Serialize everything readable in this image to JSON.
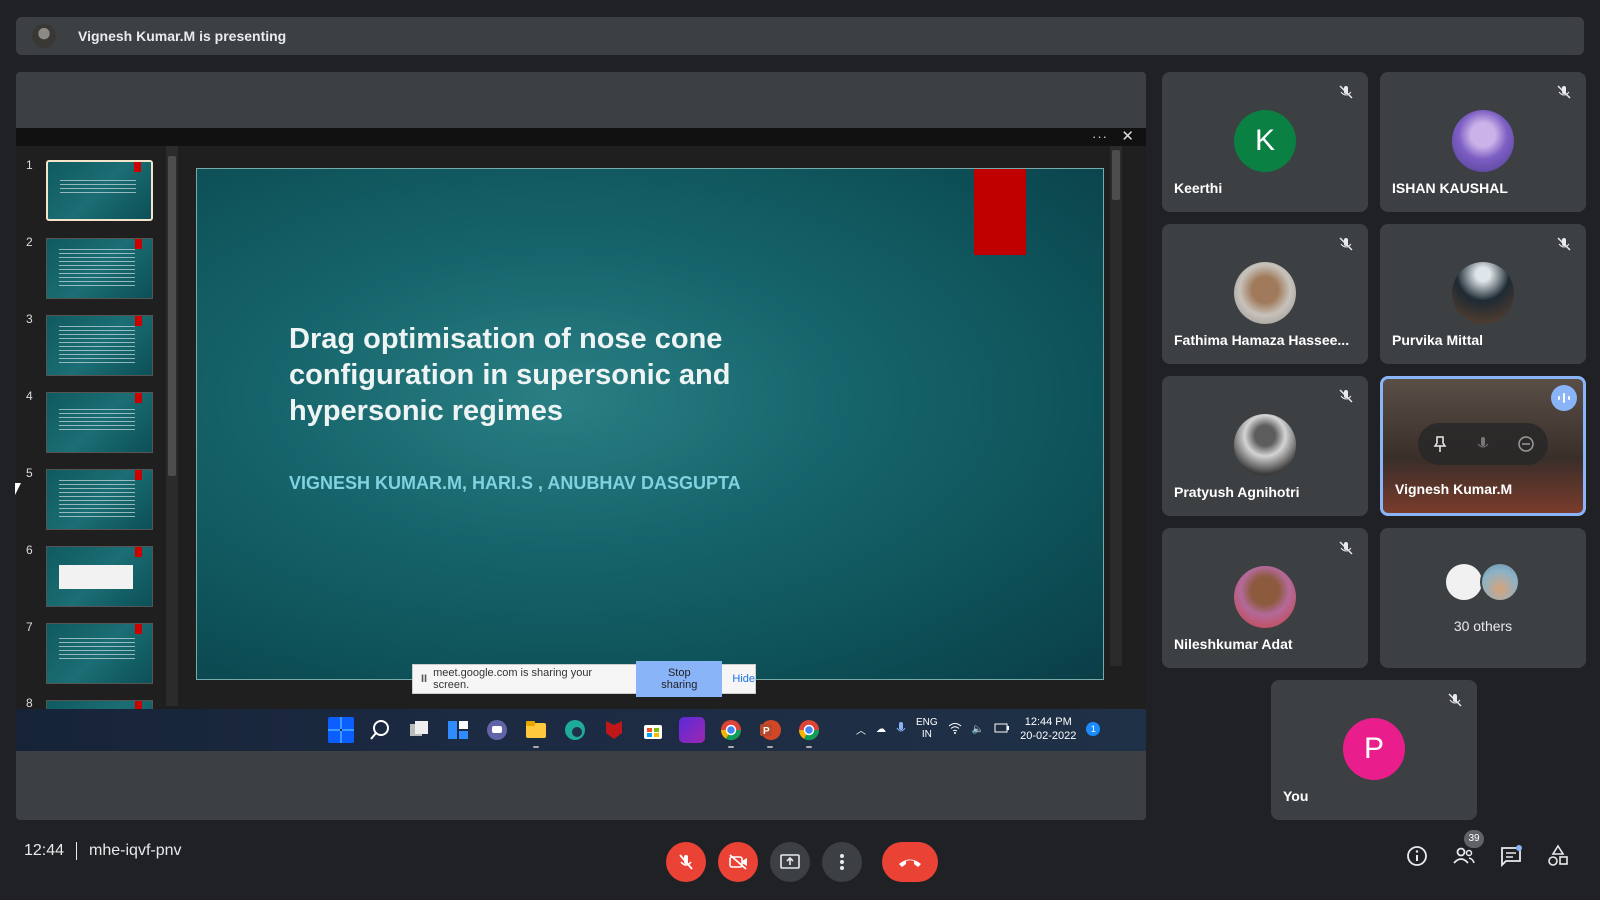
{
  "banner": {
    "text": "Vignesh Kumar.M is presenting"
  },
  "ppt": {
    "menu_dots": "···",
    "close": "✕"
  },
  "thumbnails": [
    "1",
    "2",
    "3",
    "4",
    "5",
    "6",
    "7",
    "8"
  ],
  "slide": {
    "title": "Drag optimisation of nose cone configuration in supersonic and hypersonic regimes",
    "authors": "VIGNESH KUMAR.M, HARI.S , ANUBHAV DASGUPTA"
  },
  "sharebar": {
    "text": "meet.google.com is sharing your screen.",
    "stop": "Stop sharing",
    "hide": "Hide"
  },
  "taskbar": {
    "lang1": "ENG",
    "lang2": "IN",
    "time": "12:44 PM",
    "date": "20-02-2022"
  },
  "participants": [
    {
      "name": "Keerthi",
      "initial": "K",
      "color": "#0b8043"
    },
    {
      "name": "ISHAN KAUSHAL"
    },
    {
      "name": "Fathima Hamaza Hassee..."
    },
    {
      "name": "Purvika Mittal"
    },
    {
      "name": "Pratyush Agnihotri"
    },
    {
      "name": "Vignesh Kumar.M"
    },
    {
      "name": "Nileshkumar Adat"
    },
    {
      "name": "You",
      "initial": "P",
      "color": "#e91e8c"
    }
  ],
  "others": {
    "label": "30 others"
  },
  "meeting": {
    "time": "12:44",
    "code": "mhe-iqvf-pnv"
  },
  "people_count": "39",
  "colors": {
    "accent": "#8ab4f8",
    "danger": "#ea4335",
    "surface": "#3c4043",
    "bg": "#202124"
  }
}
